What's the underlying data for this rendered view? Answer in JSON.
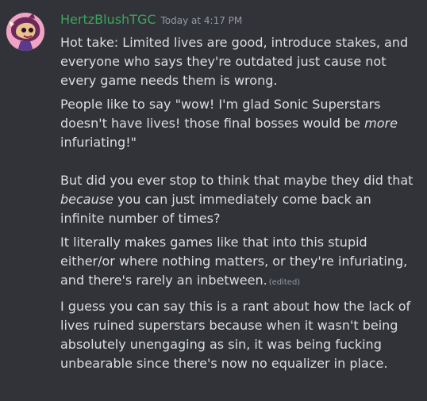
{
  "message": {
    "username": "HertzBlushTGC",
    "timestamp": "Today at 4:17 PM",
    "colors": {
      "username": "#3ba55c",
      "background": "#313338",
      "text": "#dbdee1",
      "muted": "#949ba4"
    },
    "avatar_icon": "avatar-icon",
    "p1": "Hot take: Limited lives are good, introduce stakes, and everyone who says they're outdated just cause not every game needs them is wrong.",
    "p2_a": "People like to say \"wow! I'm glad Sonic Superstars doesn't have lives! those final bosses would be ",
    "p2_em": "more",
    "p2_b": " infuriating!\"",
    "p3_a": "But did you ever stop to think that maybe they did that ",
    "p3_em": "because",
    "p3_b": " you can just immediately come back an infinite number of times?",
    "p4": "It literally makes games like that into this stupid either/or where nothing matters, or they're infuriating, and there's rarely an inbetween.",
    "edited": "(edited)",
    "p5": "I guess you can say this is a rant about how the lack of lives ruined superstars because when it wasn't being absolutely unengaging as sin, it was being fucking unbearable since there's now no equalizer in place."
  }
}
